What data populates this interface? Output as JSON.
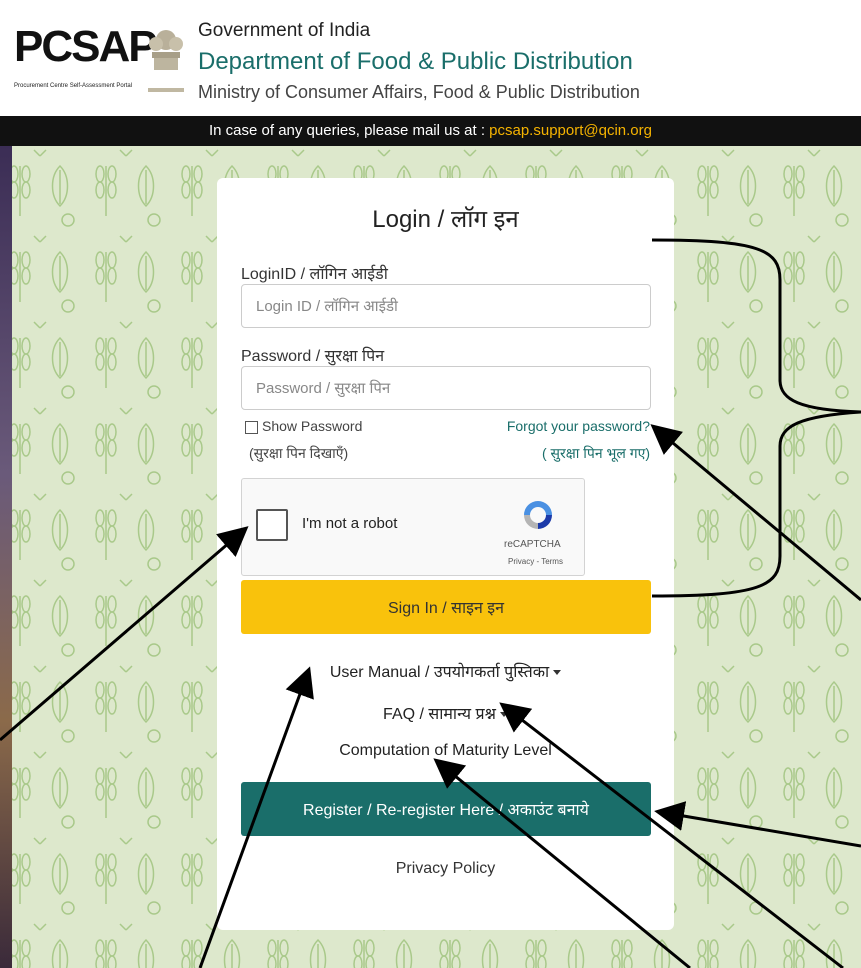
{
  "header": {
    "logo_text": "PCSAP",
    "logo_subtitle": "Procurement Centre Self-Assessment Portal",
    "government": "Government of India",
    "department": "Department of Food & Public Distribution",
    "ministry": "Ministry of  Consumer Affairs, Food & Public Distribution"
  },
  "query_bar": {
    "text": "In case of any queries, please mail us at : ",
    "email": "pcsap.support@qcin.org"
  },
  "login": {
    "title": "Login / लॉग इन",
    "login_id_label": "LoginID / लॉगिन आईडी",
    "login_id_placeholder": "Login ID / लॉगिन आईडी",
    "password_label": "Password / सुरक्षा पिन",
    "password_placeholder": "Password / सुरक्षा पिन",
    "show_password": "Show Password",
    "show_password_hindi": "(सुरक्षा पिन दिखाएँ)",
    "forgot_password": "Forgot your password?",
    "forgot_password_hindi": "( सुरक्षा पिन भूल गए)",
    "sign_in": "Sign In / साइन इन"
  },
  "recaptcha": {
    "label": "I'm not a robot",
    "brand": "reCAPTCHA",
    "links": "Privacy - Terms"
  },
  "links": {
    "user_manual": "User Manual / उपयोगकर्ता पुस्तिका",
    "faq": "FAQ / सामान्य प्रश्न",
    "computation": "Computation of Maturity Level",
    "register": "Register / Re-register Here / अकाउंट बनाये",
    "privacy": "Privacy Policy"
  },
  "colors": {
    "accent_teal": "#1a6e6a",
    "signin_yellow": "#f9c20c",
    "email_orange": "#f5b301"
  }
}
